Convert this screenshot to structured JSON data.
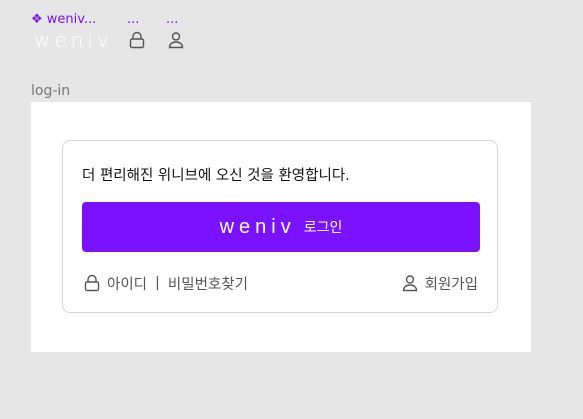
{
  "colors": {
    "background": "#e6e6e6",
    "accent": "#7a12ff",
    "label_accent": "#7a43f0"
  },
  "topbar": {
    "component_label": "❖ weniv...",
    "dots_1": "...",
    "dots_2": "...",
    "wordmark": "weniv",
    "icons": [
      "lock-icon",
      "user-icon"
    ]
  },
  "section": {
    "label": "log-in"
  },
  "login": {
    "welcome": "더 편리해진 위니브에 오신 것을 환영합니다.",
    "button_logo": "weniv",
    "button_text": "로그인",
    "id_link": "아이디",
    "separator": "|",
    "password_link": "비밀번호찾기",
    "signup_link": "회원가입"
  }
}
